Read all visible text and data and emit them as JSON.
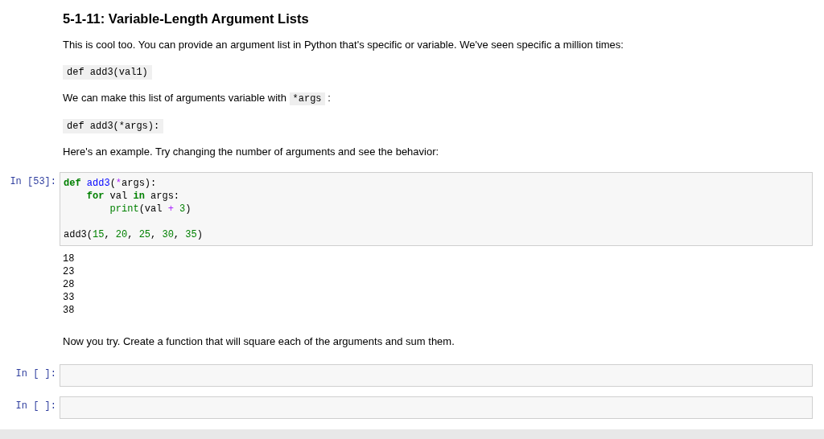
{
  "heading": "5-1-11: Variable-Length Argument Lists",
  "markdown": [
    {
      "kind": "text",
      "text": "This is cool too. You can provide an argument list in Python that's specific or variable. We've seen specific a million times:"
    },
    {
      "kind": "code",
      "text": "def add3(val1)"
    },
    {
      "kind": "text",
      "text": "We can make this list of arguments variable with",
      "code": "*args",
      "after": ":"
    },
    {
      "kind": "code",
      "text": "def add3(*args):"
    },
    {
      "kind": "text",
      "text": "Here's an example. Try changing the number of arguments and see the behavior:"
    }
  ],
  "code_cell": {
    "prompt": "In [53]:",
    "lines": [
      {
        "kind": "code",
        "tokens": [
          {
            "text": "def",
            "kind": "keyword"
          },
          {
            "text": " add3",
            "kind": "name"
          },
          {
            "text": "(",
            "kind": "plain"
          },
          {
            "text": "*",
            "kind": "operator"
          },
          {
            "text": "args):",
            "kind": "plain"
          }
        ]
      },
      {
        "kind": "code",
        "tokens": [
          {
            "text": "    for",
            "kind": "keyword"
          },
          {
            "text": " val ",
            "kind": "plain"
          },
          {
            "text": "in",
            "kind": "keyword"
          },
          {
            "text": " args:",
            "kind": "plain"
          }
        ]
      },
      {
        "kind": "code",
        "tokens": [
          {
            "text": "        print",
            "kind": "builtin"
          },
          {
            "text": "(val ",
            "kind": "plain"
          },
          {
            "text": "+",
            "kind": "operator"
          },
          {
            "text": " 3",
            "kind": "number"
          },
          {
            "text": ")",
            "kind": "plain"
          }
        ]
      },
      {
        "kind": "blank"
      },
      {
        "kind": "code",
        "tokens": [
          {
            "text": "add3(",
            "kind": "plain"
          },
          {
            "text": "15",
            "kind": "number"
          },
          {
            "text": ", ",
            "kind": "plain"
          },
          {
            "text": "20",
            "kind": "number"
          },
          {
            "text": ", ",
            "kind": "plain"
          },
          {
            "text": "25",
            "kind": "number"
          },
          {
            "text": ", ",
            "kind": "plain"
          },
          {
            "text": "30",
            "kind": "number"
          },
          {
            "text": ", ",
            "kind": "plain"
          },
          {
            "text": "35",
            "kind": "number"
          },
          {
            "text": ")",
            "kind": "plain"
          }
        ]
      }
    ],
    "output": [
      "18",
      "23",
      "28",
      "33",
      "38"
    ]
  },
  "prompt_text": "Now you try. Create a function that will square each of the arguments and sum them.",
  "empty_cells": [
    {
      "prompt": "In [ ]:"
    },
    {
      "prompt": "In [ ]:"
    }
  ]
}
